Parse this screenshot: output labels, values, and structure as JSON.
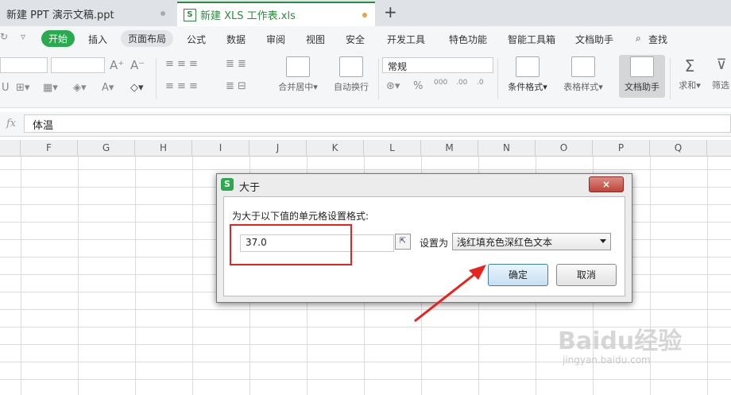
{
  "tabs": [
    {
      "label": "新建 PPT 演示文稿.ppt"
    },
    {
      "label": "新建 XLS 工作表.xls",
      "icon_text": "S"
    }
  ],
  "menu": [
    "开始",
    "插入",
    "页面布局",
    "公式",
    "数据",
    "审阅",
    "视图",
    "安全",
    "开发工具",
    "特色功能",
    "智能工具箱",
    "文档助手",
    "查找"
  ],
  "toolbar": {
    "number_format": "常规",
    "merge_center": "合并居中",
    "wrap_text": "自动换行",
    "conditional_format": "条件格式",
    "table_style": "表格样式",
    "doc_assistant": "文档助手",
    "sum": "求和",
    "filter": "筛选"
  },
  "formula_bar": {
    "fx": "fx",
    "content": "体温"
  },
  "columns": [
    "F",
    "G",
    "H",
    "I",
    "J",
    "K",
    "L",
    "M",
    "N",
    "O",
    "P",
    "Q"
  ],
  "dialog": {
    "logo": "S",
    "title": "大于",
    "close": "×",
    "prompt": "为大于以下值的单元格设置格式:",
    "value": "37.0",
    "set_as": "设置为",
    "style": "浅红填充色深红色文本",
    "ok": "确定",
    "cancel": "取消"
  },
  "watermark": {
    "brand": "Baidu经验",
    "url": "jingyan.baidu.com"
  },
  "colors": {
    "accent": "#2aaa4f",
    "annotation": "#e8231e"
  }
}
